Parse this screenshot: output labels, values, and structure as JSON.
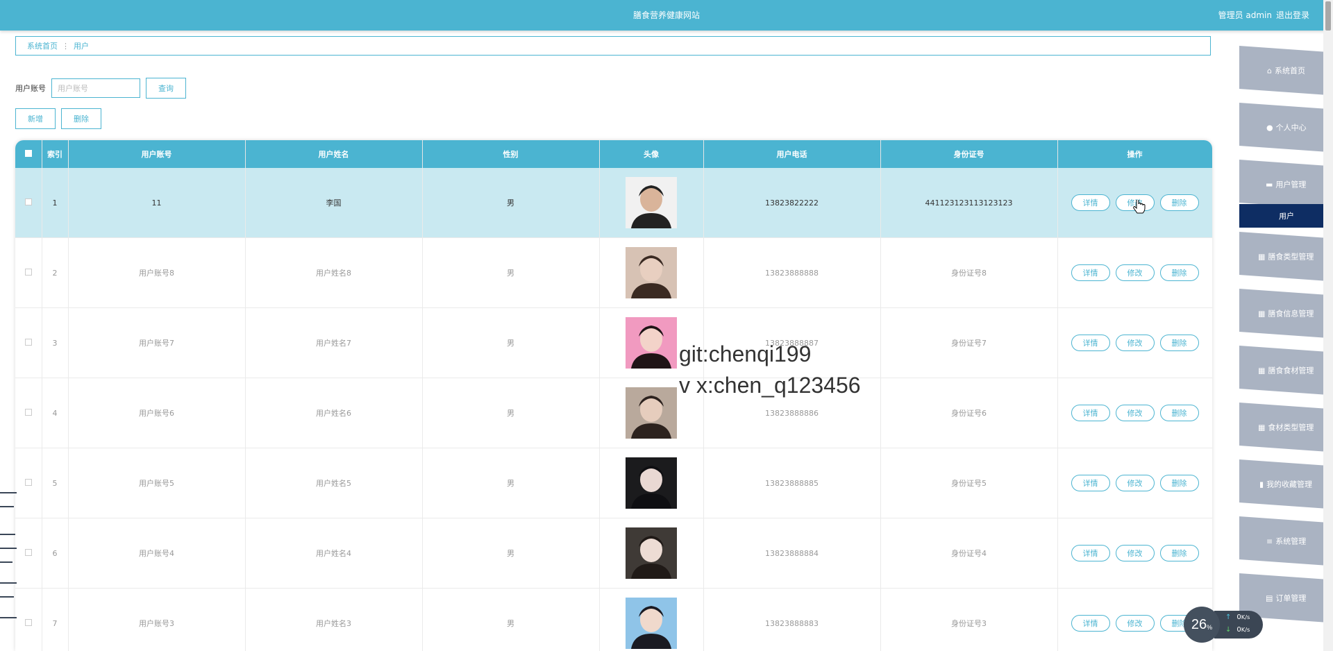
{
  "header": {
    "site_title": "膳食营养健康网站",
    "user_label": "管理员 admin",
    "logout_label": "退出登录"
  },
  "breadcrumb": {
    "home": "系统首页",
    "separator": "⋮",
    "current": "用户"
  },
  "search": {
    "label": "用户账号",
    "placeholder": "用户账号",
    "value": "",
    "button": "查询"
  },
  "actions": {
    "add": "新增",
    "delete": "删除"
  },
  "table": {
    "headers": [
      "索引",
      "用户账号",
      "用户姓名",
      "性别",
      "头像",
      "用户电话",
      "身份证号",
      "操作"
    ],
    "rows": [
      {
        "index": "1",
        "account": "11",
        "name": "李国",
        "gender": "男",
        "phone": "13823822222",
        "id_no": "441123123113123123"
      },
      {
        "index": "2",
        "account": "用户账号8",
        "name": "用户姓名8",
        "gender": "男",
        "phone": "13823888888",
        "id_no": "身份证号8"
      },
      {
        "index": "3",
        "account": "用户账号7",
        "name": "用户姓名7",
        "gender": "男",
        "phone": "13823888887",
        "id_no": "身份证号7"
      },
      {
        "index": "4",
        "account": "用户账号6",
        "name": "用户姓名6",
        "gender": "男",
        "phone": "13823888886",
        "id_no": "身份证号6"
      },
      {
        "index": "5",
        "account": "用户账号5",
        "name": "用户姓名5",
        "gender": "男",
        "phone": "13823888885",
        "id_no": "身份证号5"
      },
      {
        "index": "6",
        "account": "用户账号4",
        "name": "用户姓名4",
        "gender": "男",
        "phone": "13823888884",
        "id_no": "身份证号4"
      },
      {
        "index": "7",
        "account": "用户账号3",
        "name": "用户姓名3",
        "gender": "男",
        "phone": "13823888883",
        "id_no": "身份证号3"
      }
    ],
    "row_actions": {
      "detail": "详情",
      "edit": "修改",
      "delete": "删除"
    }
  },
  "sidebar": {
    "items": [
      {
        "label": "系统首页",
        "icon": "home-icon"
      },
      {
        "label": "个人中心",
        "icon": "person-icon"
      },
      {
        "label": "用户管理",
        "icon": "briefcase-icon"
      },
      {
        "label": "用户",
        "icon": ""
      },
      {
        "label": "膳食类型管理",
        "icon": "grid-icon"
      },
      {
        "label": "膳食信息管理",
        "icon": "grid-icon"
      },
      {
        "label": "膳食食材管理",
        "icon": "grid-icon"
      },
      {
        "label": "食材类型管理",
        "icon": "grid-icon"
      },
      {
        "label": "我的收藏管理",
        "icon": "clipboard-icon"
      },
      {
        "label": "系统管理",
        "icon": "list-icon"
      },
      {
        "label": "订单管理",
        "icon": "table-icon"
      }
    ]
  },
  "watermark": {
    "line1": "git:chenqi199",
    "line2": "v x:chen_q123456"
  },
  "speed_widget": {
    "percent": "26",
    "percent_unit": "%",
    "upload": "0",
    "download": "0",
    "unit": "K/s"
  },
  "colors": {
    "primary": "#4bb4d1",
    "sidebar": "#aab3c2",
    "sidebar_active": "#0e2d63",
    "selected_row": "#c9e9f1"
  }
}
